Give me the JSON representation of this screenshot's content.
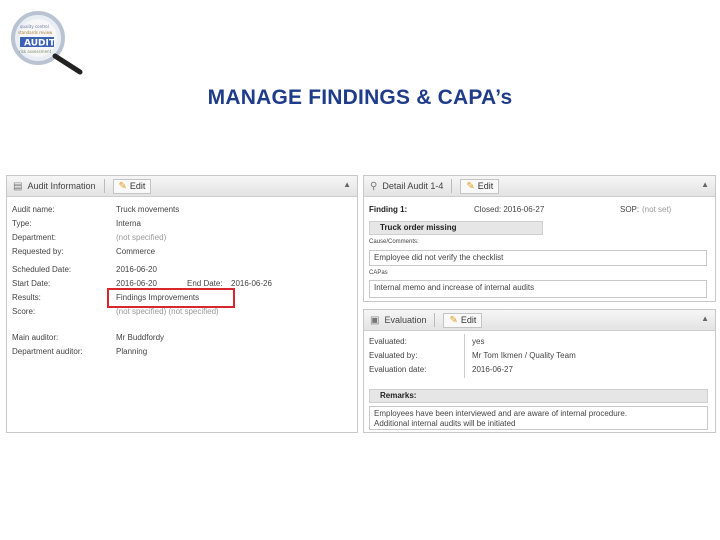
{
  "title": "MANAGE FINDINGS & CAPA’s",
  "logo": {
    "text": "AUDIT"
  },
  "audit_panel": {
    "header": "Audit Information",
    "edit_label": "Edit",
    "fields": [
      {
        "label": "Audit name:",
        "value": "Truck movements",
        "muted": false
      },
      {
        "label": "Type:",
        "value": "Interna",
        "muted": false
      },
      {
        "label": "Department:",
        "value": "(not specified)",
        "muted": true
      },
      {
        "label": "Requested by:",
        "value": "Commerce",
        "muted": false
      },
      {
        "label": "Scheduled Date:",
        "value": "2016-06-20",
        "muted": false
      },
      {
        "label": "Start Date:",
        "value": "2016-06-20",
        "muted": false
      },
      {
        "label": "Results:",
        "value": "Findings Improvements",
        "muted": false
      },
      {
        "label": "Score:",
        "value": "(not specified) (not specified)",
        "muted": true
      },
      {
        "label": "Main auditor:",
        "value": "Mr Buddfordy",
        "muted": false
      },
      {
        "label": "Department auditor:",
        "value": "Planning",
        "muted": false
      }
    ],
    "end_date_label": "End Date:",
    "end_date_value": "2016-06-26"
  },
  "detail_panel": {
    "header": "Detail Audit 1-4",
    "edit_label": "Edit",
    "finding_label": "Finding 1:",
    "closed_label": "Closed: 2016-06-27",
    "sop_label": "SOP:",
    "sop_value": "(not set)",
    "sub_header": "Truck order missing",
    "cause_label": "Cause/Comments:",
    "cause_text": "Employee did not verify the checklist",
    "capa_label": "CAPas",
    "capa_text": "Internal memo and increase of internal audits"
  },
  "evaluation_panel": {
    "header": "Evaluation",
    "edit_label": "Edit",
    "fields": [
      {
        "label": "Evaluated:",
        "value": "yes"
      },
      {
        "label": "Evaluated by:",
        "value": "Mr Tom Ikmen / Quality Team"
      },
      {
        "label": "Evaluation date:",
        "value": "2016-06-27"
      }
    ],
    "remarks_label": "Remarks:",
    "remarks_line1": "Employees have been interviewed and are aware of internal procedure.",
    "remarks_line2": "Additional internal audits will be initiated"
  },
  "colors": {
    "title": "#1f3c8a",
    "highlight": "#d7262c",
    "edit_icon": "#e09b1a"
  }
}
